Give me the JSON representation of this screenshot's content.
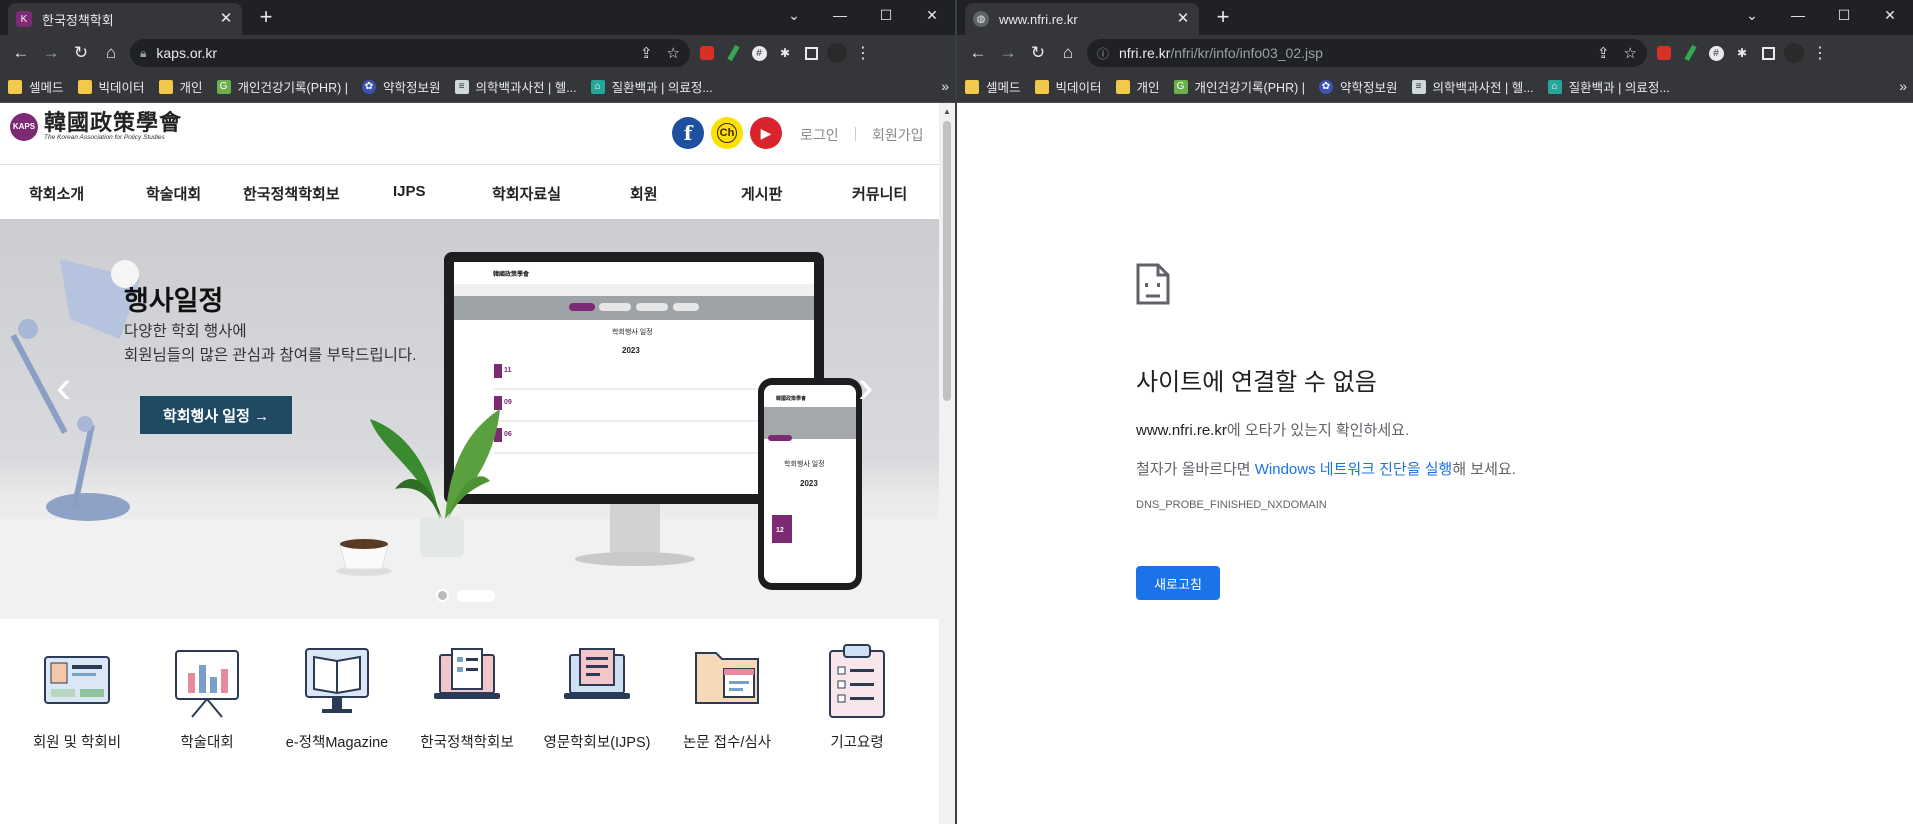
{
  "left": {
    "tab_title": "한국정책학회",
    "url": "kaps.or.kr",
    "bookmarks": [
      "셀메드",
      "빅데이터",
      "개인",
      "개인건강기록(PHR) |",
      "약학정보원",
      "의학백과사전 | 헬...",
      "질환백과 | 의료정..."
    ],
    "site": {
      "logo_text": "韓國政策學會",
      "logo_sub": "The Korean Association for Policy Studies",
      "logo_badge": "KAPS",
      "sns_kakao": "Ch",
      "login": "로그인",
      "signup": "회원가입",
      "menu": [
        "학회소개",
        "학술대회",
        "한국정책학회보",
        "IJPS",
        "학회자료실",
        "회원",
        "게시판",
        "커뮤니티"
      ],
      "hero": {
        "title": "행사일정",
        "sub1": "다양한 학회 행사에",
        "sub2": "회원님들의 많은 관심과 참여를 부탁드립니다.",
        "button": "학회행사 일정 →",
        "prev": "‹",
        "next": "›",
        "mock_heading": "학회행사 일정",
        "mock_year": "2023",
        "mock_days": [
          "11",
          "09",
          "06"
        ],
        "mock_phone_day": "12",
        "mock_logo": "韓國政策學會"
      },
      "quick_links": [
        "회원 및 학회비",
        "학술대회",
        "e-정책Magazine",
        "한국정책학회보",
        "영문학회보(IJPS)",
        "논문 접수/심사",
        "기고요령"
      ]
    }
  },
  "right": {
    "tab_title": "www.nfri.re.kr",
    "url_host": "nfri.re.kr",
    "url_path": "/nfri/kr/info/info03_02.jsp",
    "bookmarks": [
      "셀메드",
      "빅데이터",
      "개인",
      "개인건강기록(PHR) |",
      "약학정보원",
      "의학백과사전 | 헬...",
      "질환백과 | 의료정..."
    ],
    "error": {
      "title": "사이트에 연결할 수 없음",
      "line1_host": "www.nfri.re.kr",
      "line1_rest": "에 오타가 있는지 확인하세요.",
      "line2_pre": "철자가 올바르다면 ",
      "line2_link": "Windows 네트워크 진단을 실행",
      "line2_post": "해 보세요.",
      "code": "DNS_PROBE_FINISHED_NXDOMAIN",
      "reload": "새로고침"
    }
  },
  "colors": {
    "brand": "#7b2a73",
    "cta": "#1f4a63",
    "chrome_dark": "#202124",
    "chrome_mid": "#35363a",
    "link_blue": "#1a73e8"
  }
}
